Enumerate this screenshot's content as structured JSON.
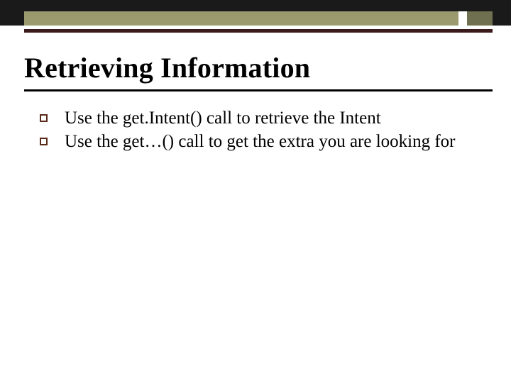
{
  "colors": {
    "accent_olive": "#9a9a6e",
    "accent_olive_dark": "#6f7050",
    "band": "#1a1a1a",
    "rule": "#3a1a1a",
    "bullet_border": "#5a2a1a"
  },
  "slide": {
    "title": "Retrieving Information",
    "bullets": [
      "Use the get.Intent() call to retrieve the Intent",
      "Use the get…() call to get the extra you are looking for"
    ]
  }
}
